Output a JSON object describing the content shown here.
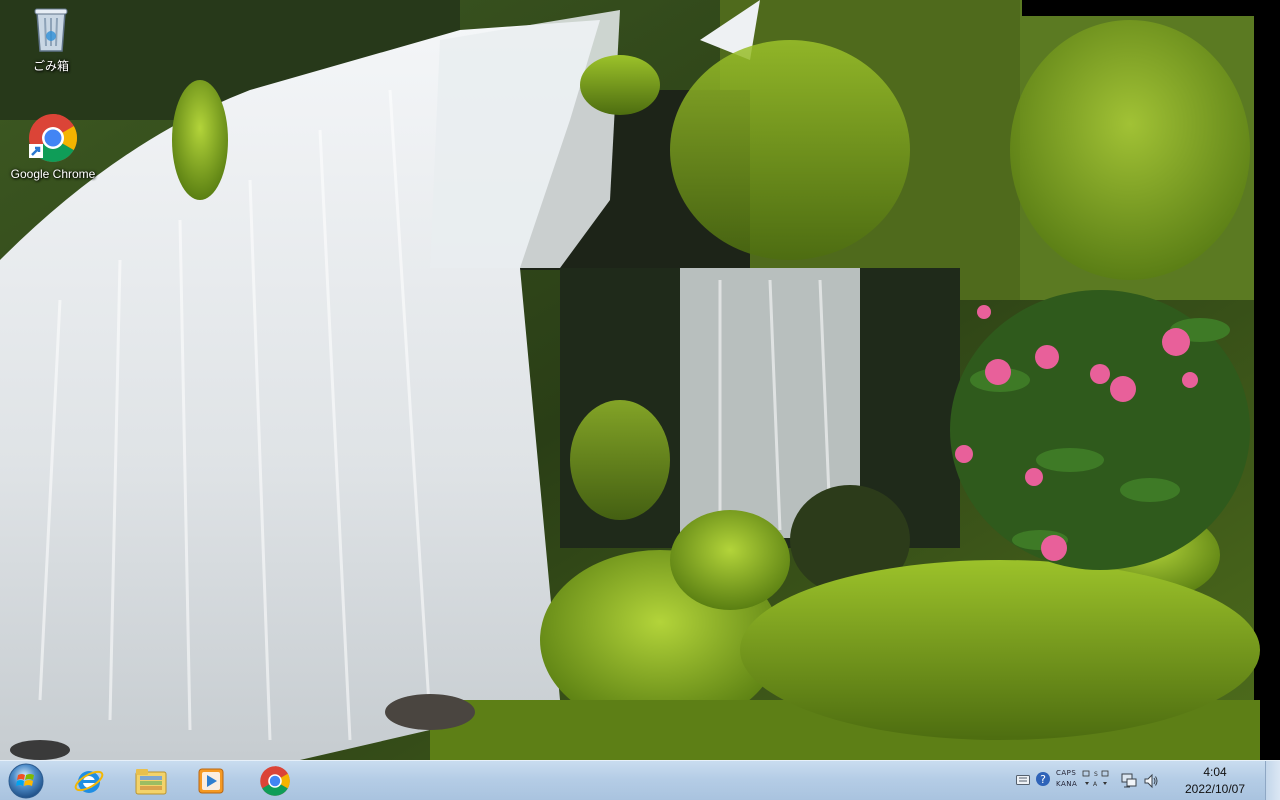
{
  "desktop": {
    "icons": [
      {
        "label": "ごみ箱",
        "icon": "recycle-bin-icon"
      },
      {
        "label": "Google Chrome",
        "icon": "chrome-icon"
      }
    ]
  },
  "taskbar": {
    "start": {
      "icon": "windows-orb-icon"
    },
    "pinned": [
      {
        "name": "Internet Explorer",
        "icon": "internet-explorer-icon"
      },
      {
        "name": "Windows Explorer",
        "icon": "folder-library-icon"
      },
      {
        "name": "Windows Media Player",
        "icon": "media-player-icon"
      },
      {
        "name": "Google Chrome",
        "icon": "chrome-icon"
      }
    ],
    "tray": {
      "ime": {
        "caps": "CAPS",
        "kana": "KANA"
      },
      "clock": {
        "time": "4:04",
        "date": "2022/10/07"
      }
    }
  },
  "colors": {
    "taskbar": "#b5cde6",
    "chrome_red": "#db4437",
    "chrome_yellow": "#f4b400",
    "chrome_green": "#0f9d58",
    "chrome_blue": "#4285f4"
  }
}
